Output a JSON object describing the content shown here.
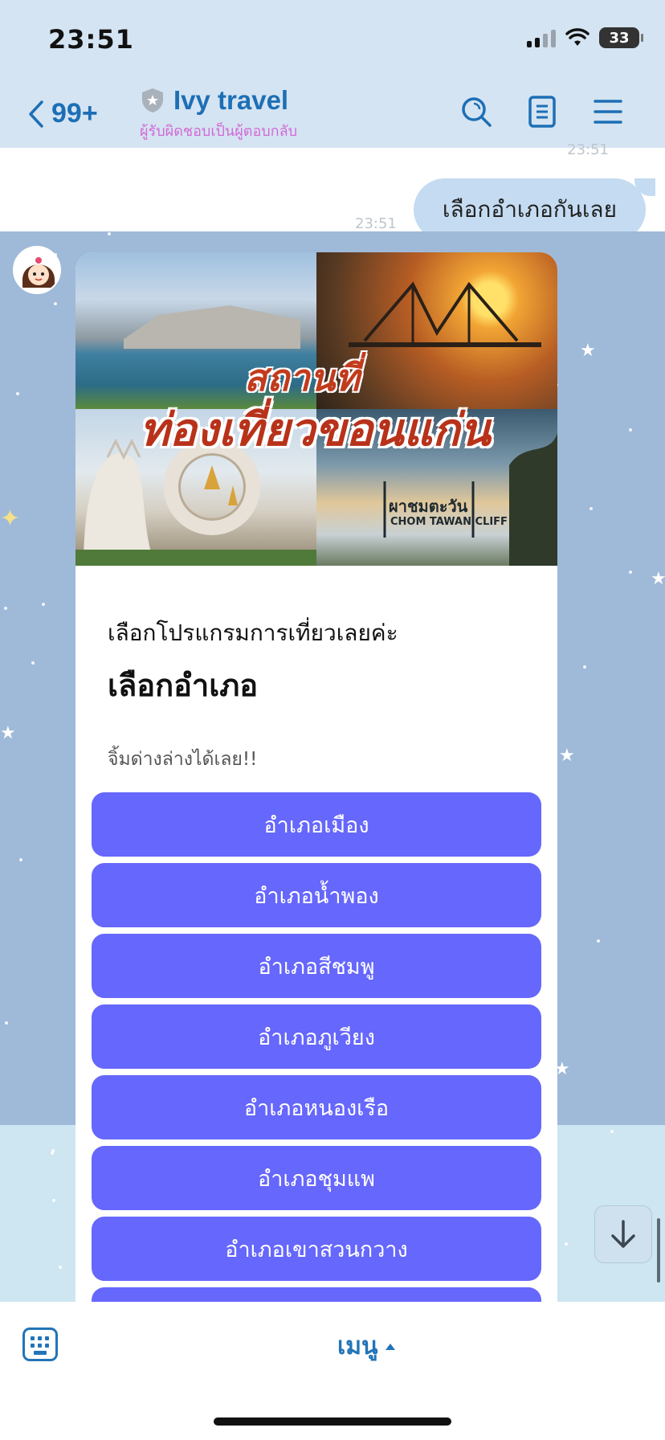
{
  "status_bar": {
    "time": "23:51",
    "battery": "33"
  },
  "header": {
    "back_count": "99+",
    "title": "Ivy travel",
    "subtitle": "ผู้รับผิดชอบเป็นผู้ตอบกลับ",
    "icons": [
      "search-icon",
      "notes-icon",
      "menu-icon"
    ]
  },
  "chat": {
    "outgoing": {
      "text": "เลือกอำเภอกันเลย",
      "time": "23:51"
    },
    "incoming_time": "23:51",
    "card": {
      "image_title_small": "สถานที่",
      "image_title_big": "ท่องเที่ยวขอนแก่น",
      "image_sign": "ผาชมตะวัน",
      "image_sign_en": "CHOM TAWAN CLIFF",
      "lead": "เลือกโปรแกรมการเที่ยวเลยค่ะ",
      "heading": "เลือกอำเภอ",
      "hint": "จิ้มด่างล่างได้เลย!!",
      "buttons": [
        "อำเภอเมือง",
        "อำเภอน้ำพอง",
        "อำเภอสีชมพู",
        "อำเภอภูเวียง",
        "อำเภอหนองเรือ",
        "อำเภอชุมแพ",
        "อำเภอเขาสวนกวาง"
      ]
    }
  },
  "footer": {
    "menu_label": "เมนู"
  },
  "colors": {
    "header_bg": "#d5e4f2",
    "accent": "#1d6fb5",
    "button": "#6667fc",
    "bubble_out": "#c4dbf1"
  }
}
